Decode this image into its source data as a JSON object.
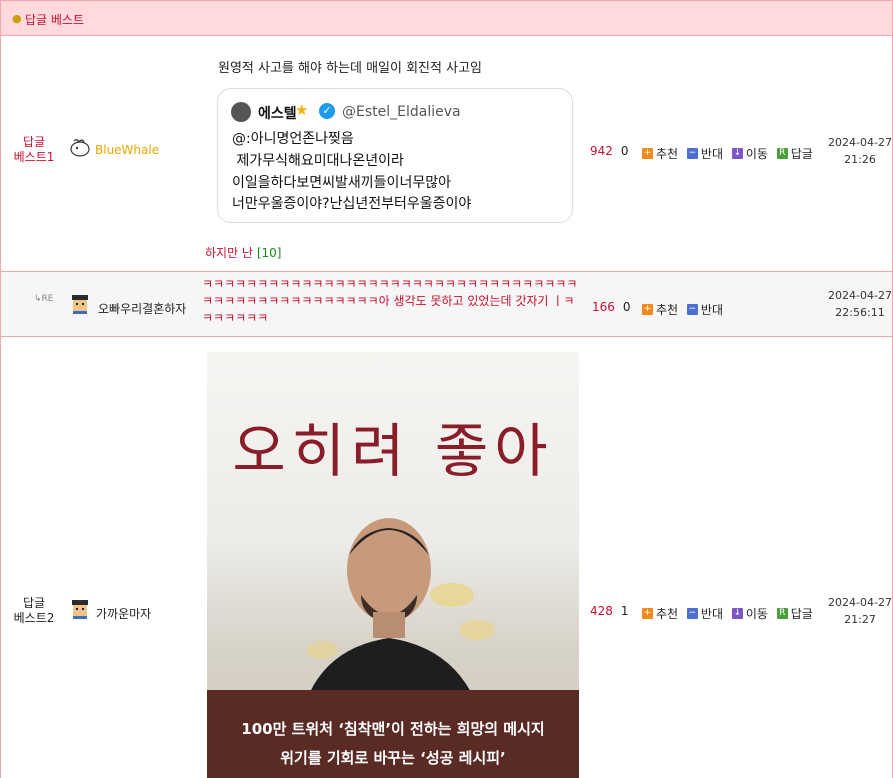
{
  "header": {
    "title": "답글 베스트"
  },
  "row1": {
    "rank_line1": "답글",
    "rank_line2": "베스트1",
    "nickname": "BlueWhale",
    "caption": "원영적 사고를 해야 하는데 매일이 회진적 사고임",
    "tweet": {
      "name": "에스텔",
      "handle": "@Estel_Eldalieva",
      "lines": [
        "@:아니명언존나찢음",
        " 제가무식해요미대나온년이라",
        "이일을하다보면씨발새끼들이너무많아",
        "너만우울증이야?난십년전부터우울증이야"
      ]
    },
    "footer_text": "하지만 난",
    "comment_count": "[10]",
    "score": "942",
    "count": "0",
    "actions": {
      "up": "추천",
      "down": "반대",
      "move": "이동",
      "reply": "답글"
    },
    "date": "2024-04-27",
    "time": "21:26"
  },
  "row2": {
    "re_label": "RE",
    "nickname": "오빠우리결혼하자",
    "text": "ㅋㅋㅋㅋㅋㅋㅋㅋㅋㅋㅋㅋㅋㅋㅋㅋㅋㅋㅋㅋㅋㅋㅋㅋㅋㅋㅋㅋㅋㅋㅋㅋㅋㅋㅋㅋㅋㅋㅋㅋㅋㅋㅋㅋㅋㅋㅋㅋㅋㅋ아 생각도 못하고 있었는데 갓자기 ㅣㅋㅋㅋㅋㅋㅋㅋ",
    "score": "166",
    "count": "0",
    "actions": {
      "up": "추천",
      "down": "반대"
    },
    "date": "2024-04-27",
    "time": "22:56:11"
  },
  "row3": {
    "rank_line1": "답글",
    "rank_line2": "베스트2",
    "nickname": "가까운마자",
    "book": {
      "title": "오히려 좋아",
      "line1": "100만 트위처 ‘침착맨’이 전하는 희망의 메시지",
      "line2": "위기를 기회로 바꾸는 ‘성공 레시피’"
    },
    "score": "428",
    "count": "1",
    "actions": {
      "up": "추천",
      "down": "반대",
      "move": "이동",
      "reply": "답글"
    },
    "date": "2024-04-27",
    "time": "21:27"
  }
}
